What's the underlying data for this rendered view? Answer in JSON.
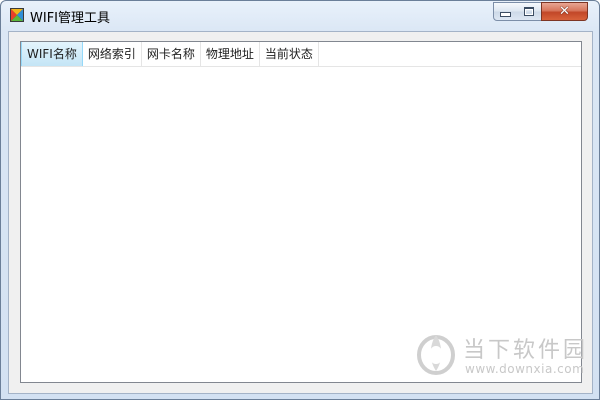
{
  "window": {
    "title": "WIFI管理工具",
    "close_symbol": "✕"
  },
  "icons": {
    "app": "app-logo-icon",
    "minimize": "minimize-icon",
    "maximize": "maximize-icon",
    "close": "close-icon"
  },
  "list": {
    "columns": [
      {
        "label": "WIFI名称",
        "active": true
      },
      {
        "label": "网络索引",
        "active": false
      },
      {
        "label": "网卡名称",
        "active": false
      },
      {
        "label": "物理地址",
        "active": false
      },
      {
        "label": "当前状态",
        "active": false
      }
    ],
    "rows": []
  },
  "watermark": {
    "name": "当下软件园",
    "url": "www.downxia.com"
  },
  "colors": {
    "header_active_border": "#96d9f9",
    "close_button": "#c24728",
    "watermark": "#c8c8c8"
  }
}
